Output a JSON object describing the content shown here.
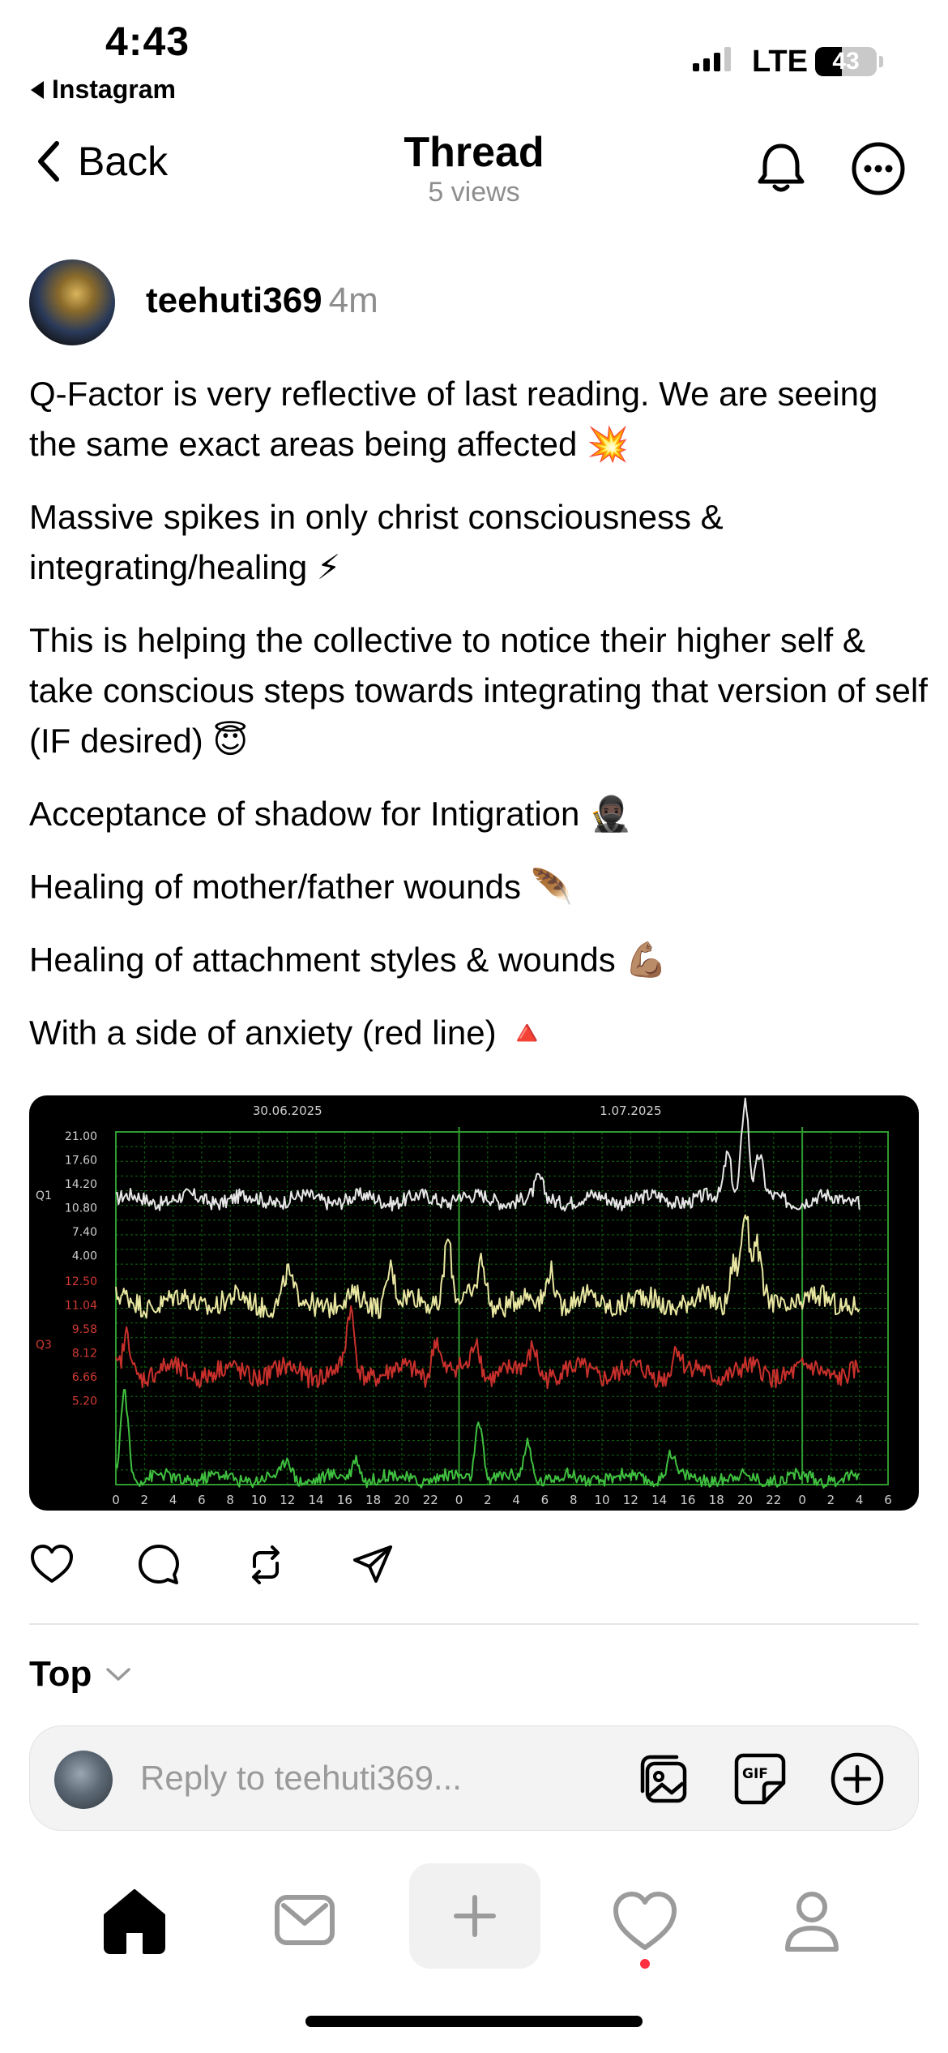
{
  "status_bar": {
    "time": "4:43",
    "back_app": "Instagram",
    "network": "LTE",
    "battery": "43"
  },
  "header": {
    "back_label": "Back",
    "title": "Thread",
    "views": "5 views"
  },
  "post": {
    "username": "teehuti369",
    "time_ago": "4m",
    "paragraphs": [
      "Q-Factor is very reflective of last reading. We are seeing the same exact areas being affected 💥",
      "Massive spikes in only christ consciousness & integrating/healing ⚡",
      "This is helping the collective to notice their higher self & take conscious steps towards integrating that version of self (IF desired) 😇",
      "Acceptance of shadow for Intigration 🥷🏿",
      "Healing of mother/father wounds 🪶",
      "Healing of attachment styles & wounds 💪🏽",
      "With a side of anxiety (red line) 🔺"
    ]
  },
  "chart_data": {
    "type": "line",
    "dates": [
      "30.06.2025",
      "1.07.2025"
    ],
    "row_labels": [
      "Q1",
      "Q3"
    ],
    "y_ticks_white": [
      "21.00",
      "17.60",
      "14.20",
      "10.80",
      "7.40",
      "4.00"
    ],
    "y_ticks_red": [
      "12.50",
      "11.04",
      "9.58",
      "8.12",
      "6.66",
      "5.20"
    ],
    "x_ticks": [
      "0",
      "2",
      "4",
      "6",
      "8",
      "10",
      "12",
      "14",
      "16",
      "18",
      "20",
      "22",
      "0",
      "2",
      "4",
      "6",
      "8",
      "10",
      "12",
      "14",
      "16",
      "18",
      "20",
      "22",
      "0",
      "2",
      "4",
      "6"
    ],
    "grid": true,
    "series": [
      {
        "color": "#e6e6e6",
        "base": 5.0,
        "amp": 0.9,
        "spikes": [
          [
            12,
            0.4
          ],
          [
            14.8,
            1.1
          ],
          [
            21.4,
            2.9
          ],
          [
            22.0,
            6.4
          ],
          [
            22.5,
            2.6
          ]
        ]
      },
      {
        "color": "#e8e6a0",
        "base": 3.2,
        "amp": 1.4,
        "spikes": [
          [
            6.0,
            1.6
          ],
          [
            9.6,
            2.4
          ],
          [
            11.6,
            4.2
          ],
          [
            12.8,
            2.6
          ],
          [
            15.2,
            2.4
          ],
          [
            21.6,
            2.8
          ],
          [
            22.0,
            5.6
          ],
          [
            22.4,
            3.2
          ]
        ]
      },
      {
        "color": "#c8302c",
        "base": 2.6,
        "amp": 1.3,
        "spikes": [
          [
            0.4,
            2.4
          ],
          [
            8.2,
            3.6
          ],
          [
            11.2,
            2.4
          ],
          [
            12.6,
            2.2
          ],
          [
            14.6,
            1.6
          ],
          [
            19.6,
            1.6
          ]
        ]
      },
      {
        "color": "#3fbf3f",
        "base": 0.4,
        "amp": 0.8,
        "spikes": [
          [
            0.3,
            5.6
          ],
          [
            6.0,
            1.2
          ],
          [
            8.4,
            1.4
          ],
          [
            12.7,
            3.6
          ],
          [
            14.4,
            2.2
          ],
          [
            19.4,
            1.6
          ]
        ]
      }
    ],
    "colors": {
      "grid": "#0f6a0f",
      "grid_major": "#2f9a2f",
      "tick_text": "#d0d0d0",
      "red_text": "#d23a32"
    }
  },
  "actions": {
    "like": "heart-icon",
    "comment": "comment-icon",
    "repost": "repost-icon",
    "share": "share-icon"
  },
  "sort": {
    "label": "Top"
  },
  "reply": {
    "placeholder": "Reply to teehuti369..."
  }
}
